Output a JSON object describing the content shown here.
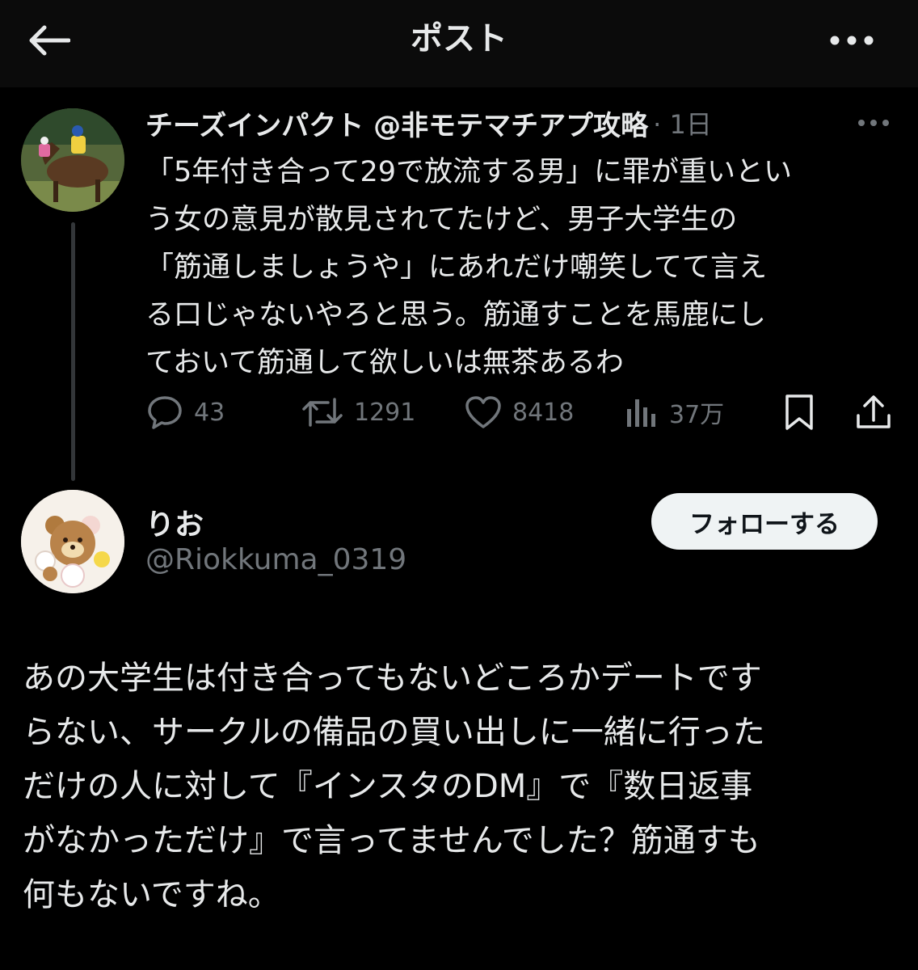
{
  "header": {
    "title": "ポスト",
    "back_icon": "arrow-left-icon",
    "more_icon": "more-horizontal-icon"
  },
  "parent_post": {
    "display_name": "チーズインパクト",
    "handle": "@非モテマチアプ攻略",
    "time": "· 1日",
    "avatar_icon": "horse-racing-avatar",
    "text_lines": [
      "「5年付き合って29で放流する男」に罪が重いとい",
      "う女の意見が散見されてたけど、男子大学生の",
      "「筋通しましょうや」にあれだけ嘲笑してて言え",
      "る口じゃないやろと思う。筋通すことを馬鹿にし",
      "ておいて筋通して欲しいは無茶あるわ"
    ],
    "actions": {
      "replies": "43",
      "reposts": "1291",
      "likes": "8418",
      "views": "37万"
    }
  },
  "reply_post": {
    "display_name": "りお",
    "handle": "@Riokkuma_0319",
    "avatar_icon": "bear-cartoon-avatar",
    "follow_label": "フォローする",
    "text_lines": [
      "あの大学生は付き合ってもないどころかデートです",
      "らない、サークルの備品の買い出しに一緒に行った",
      "だけの人に対して『インスタのDM』で『数日返事",
      "がなかっただけ』で言ってませんでした？筋通すも",
      "何もないですね。"
    ]
  },
  "colors": {
    "background": "#000000",
    "text": "#e7e9ea",
    "muted": "#71767b",
    "button_bg": "#eff3f4"
  }
}
